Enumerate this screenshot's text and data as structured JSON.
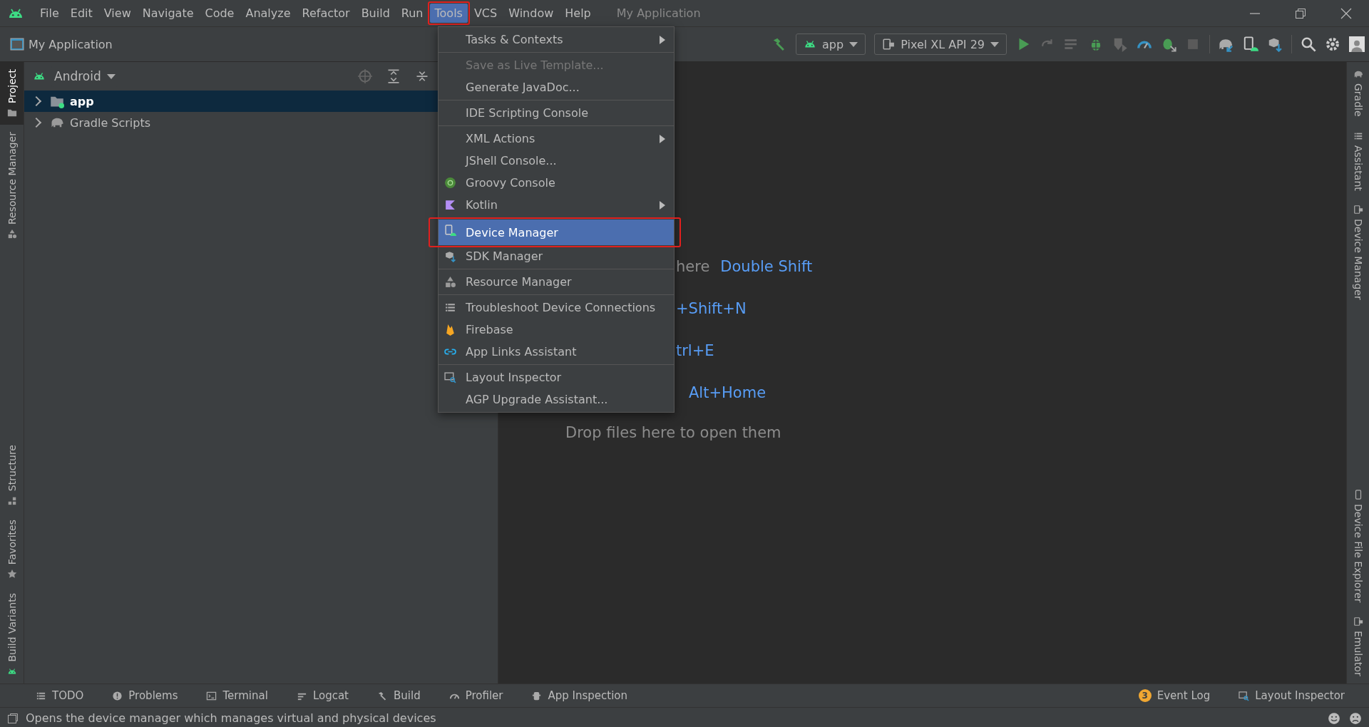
{
  "menu_bar": {
    "items": [
      {
        "label": "File",
        "selected": false,
        "annotated": false
      },
      {
        "label": "Edit",
        "selected": false,
        "annotated": false
      },
      {
        "label": "View",
        "selected": false,
        "annotated": false
      },
      {
        "label": "Navigate",
        "selected": false,
        "annotated": false
      },
      {
        "label": "Code",
        "selected": false,
        "annotated": false
      },
      {
        "label": "Analyze",
        "selected": false,
        "annotated": false
      },
      {
        "label": "Refactor",
        "selected": false,
        "annotated": false
      },
      {
        "label": "Build",
        "selected": false,
        "annotated": false
      },
      {
        "label": "Run",
        "selected": false,
        "annotated": false
      },
      {
        "label": "Tools",
        "selected": true,
        "annotated": true
      },
      {
        "label": "VCS",
        "selected": false,
        "annotated": false
      },
      {
        "label": "Window",
        "selected": false,
        "annotated": false
      },
      {
        "label": "Help",
        "selected": false,
        "annotated": false
      }
    ],
    "window_title": "My Application"
  },
  "toolbar": {
    "project": "My Application",
    "run_config": "app",
    "device": "Pixel XL API 29"
  },
  "left_stripe": [
    {
      "label": "Project",
      "selected": true
    },
    {
      "label": "Resource Manager",
      "selected": false
    },
    {
      "label": "Structure",
      "selected": false
    },
    {
      "label": "Favorites",
      "selected": false
    },
    {
      "label": "Build Variants",
      "selected": false
    }
  ],
  "right_stripe": [
    {
      "label": "Gradle"
    },
    {
      "label": "Assistant"
    },
    {
      "label": "Device Manager"
    },
    {
      "label": "Device File Explorer"
    },
    {
      "label": "Emulator"
    }
  ],
  "project_panel": {
    "view": "Android",
    "tree": [
      {
        "label": "app",
        "selected": true,
        "expanded": false
      },
      {
        "label": "Gradle Scripts",
        "selected": false,
        "expanded": false
      }
    ]
  },
  "editor": {
    "hints": [
      {
        "label": "here",
        "shortcut": "Double Shift"
      },
      {
        "shortcut": "+Shift+N"
      },
      {
        "shortcut": "trl+E"
      },
      {
        "shortcut": "Alt+Home"
      }
    ],
    "drop_text": "Drop files here to open them"
  },
  "tools_menu": [
    {
      "kind": "item",
      "label": "Tasks & Contexts",
      "submenu": true,
      "disabled": false,
      "selected": false
    },
    {
      "kind": "separator"
    },
    {
      "kind": "item",
      "label": "Save as Live Template...",
      "submenu": false,
      "disabled": true,
      "selected": false
    },
    {
      "kind": "item",
      "label": "Generate JavaDoc...",
      "submenu": false,
      "disabled": false,
      "selected": false
    },
    {
      "kind": "separator"
    },
    {
      "kind": "item",
      "label": "IDE Scripting Console",
      "submenu": false,
      "disabled": false,
      "selected": false
    },
    {
      "kind": "separator"
    },
    {
      "kind": "item",
      "label": "XML Actions",
      "submenu": true,
      "disabled": false,
      "selected": false
    },
    {
      "kind": "item",
      "label": "JShell Console...",
      "submenu": false,
      "disabled": false,
      "selected": false
    },
    {
      "kind": "item",
      "label": "Groovy Console",
      "submenu": false,
      "disabled": false,
      "selected": false
    },
    {
      "kind": "item",
      "label": "Kotlin",
      "submenu": true,
      "disabled": false,
      "selected": false
    },
    {
      "kind": "separator"
    },
    {
      "kind": "item",
      "label": "Device Manager",
      "submenu": false,
      "disabled": false,
      "selected": true,
      "annotated": true
    },
    {
      "kind": "item",
      "label": "SDK Manager",
      "submenu": false,
      "disabled": false,
      "selected": false
    },
    {
      "kind": "separator"
    },
    {
      "kind": "item",
      "label": "Resource Manager",
      "submenu": false,
      "disabled": false,
      "selected": false
    },
    {
      "kind": "separator"
    },
    {
      "kind": "item",
      "label": "Troubleshoot Device Connections",
      "submenu": false,
      "disabled": false,
      "selected": false
    },
    {
      "kind": "item",
      "label": "Firebase",
      "submenu": false,
      "disabled": false,
      "selected": false
    },
    {
      "kind": "item",
      "label": "App Links Assistant",
      "submenu": false,
      "disabled": false,
      "selected": false
    },
    {
      "kind": "separator"
    },
    {
      "kind": "item",
      "label": "Layout Inspector",
      "submenu": false,
      "disabled": false,
      "selected": false
    },
    {
      "kind": "item",
      "label": "AGP Upgrade Assistant...",
      "submenu": false,
      "disabled": false,
      "selected": false
    }
  ],
  "bottom_tabs": {
    "left": [
      {
        "label": "TODO"
      },
      {
        "label": "Problems"
      },
      {
        "label": "Terminal"
      },
      {
        "label": "Logcat"
      },
      {
        "label": "Build"
      },
      {
        "label": "Profiler"
      },
      {
        "label": "App Inspection"
      }
    ],
    "right": [
      {
        "label": "Event Log",
        "badge": "3"
      },
      {
        "label": "Layout Inspector"
      }
    ]
  },
  "status_bar": {
    "text": "Opens the device manager which manages virtual and physical devices"
  }
}
